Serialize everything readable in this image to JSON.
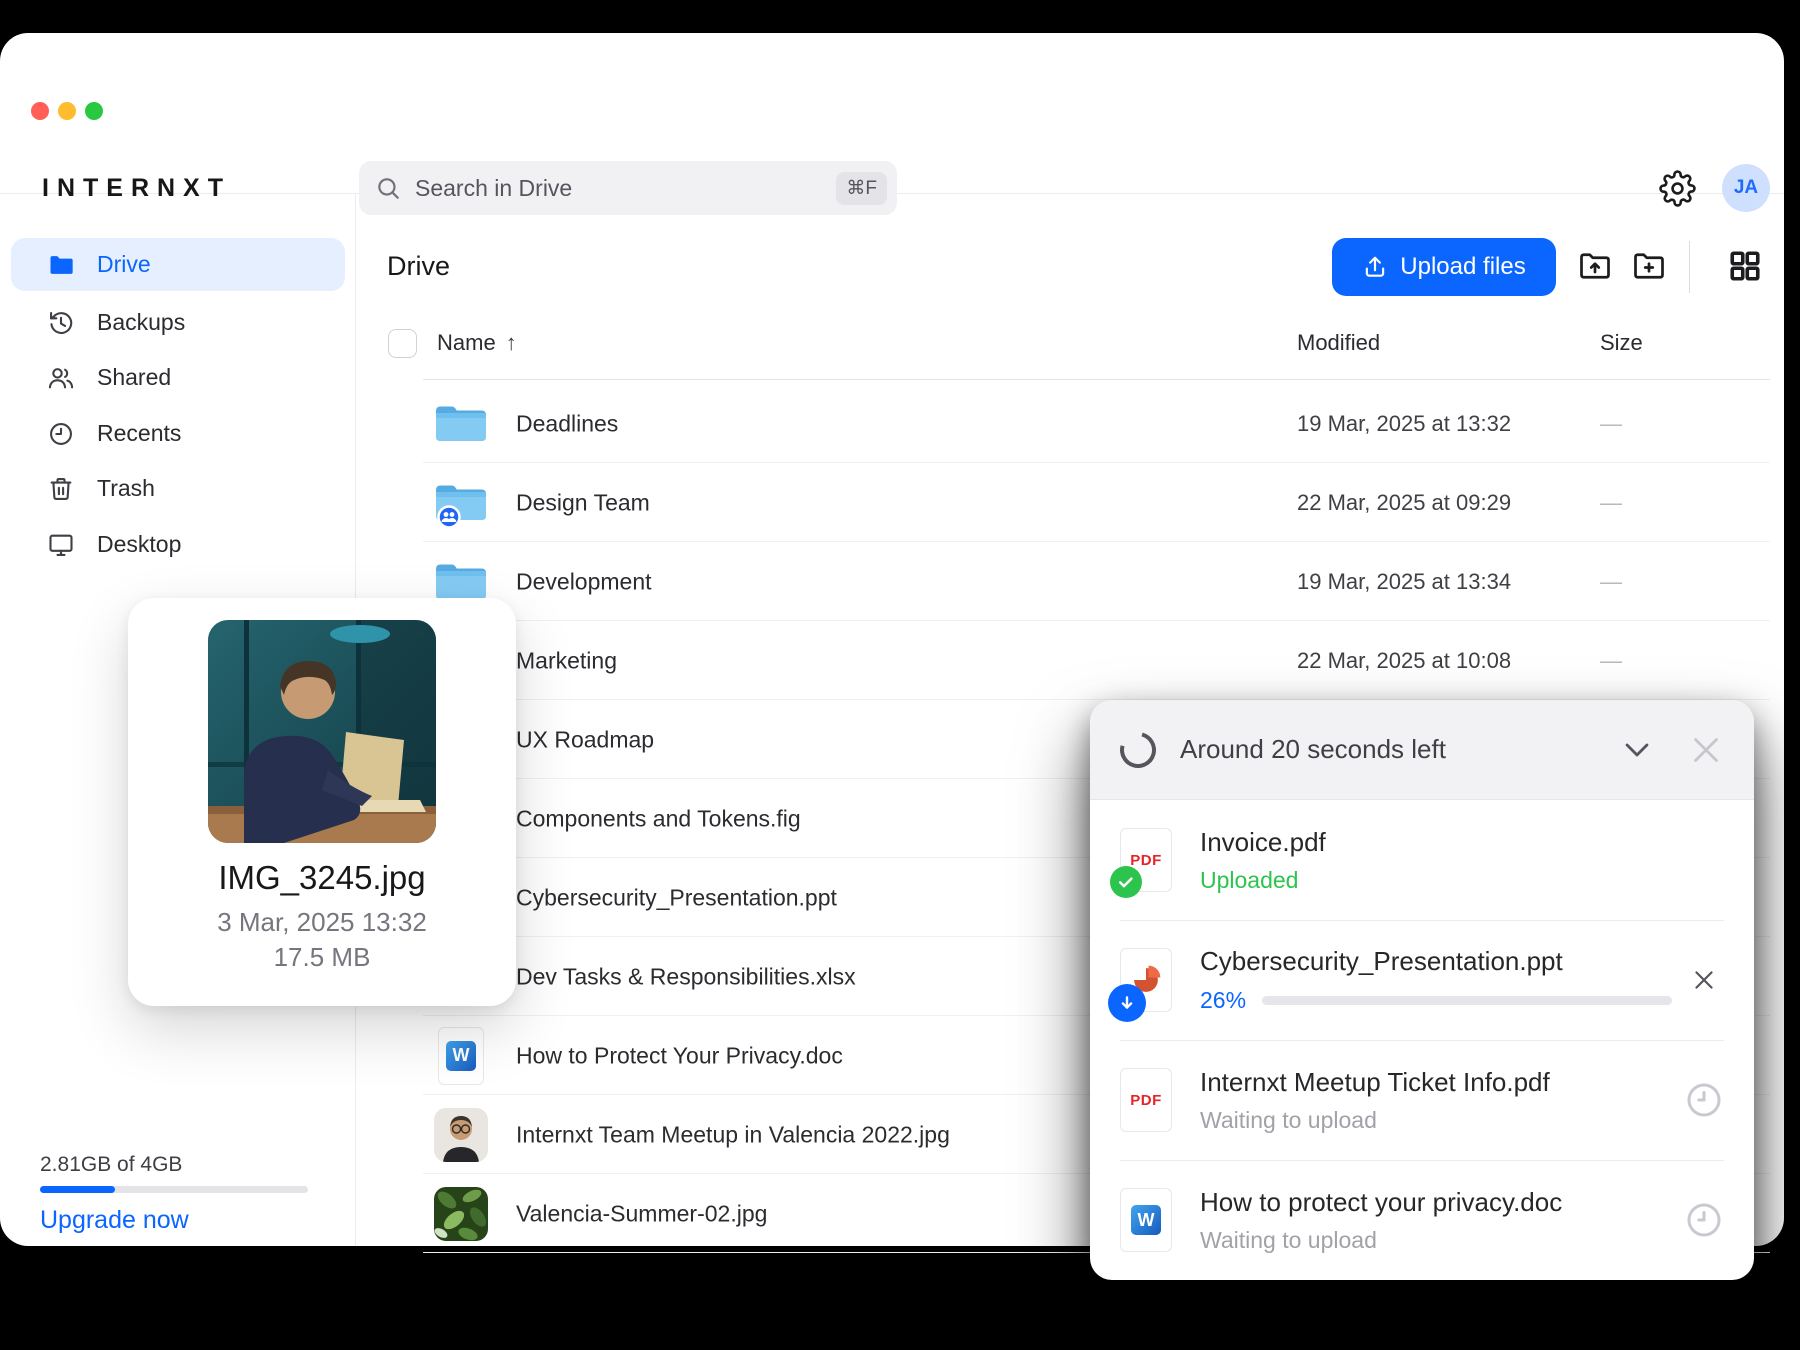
{
  "colors": {
    "accent": "#0a66ff",
    "success_green": "#2dc44d",
    "pdf_red": "#e5252a",
    "ppt_orange": "#d35230",
    "traffic_red": "#ff5f57",
    "traffic_yellow": "#febc2e",
    "traffic_green": "#28c840"
  },
  "brand": {
    "logo": "INTERNXT"
  },
  "topbar": {
    "search": {
      "placeholder": "Search in Drive",
      "shortcut": "⌘F"
    },
    "avatar_initials": "JA"
  },
  "sidebar": {
    "items": [
      {
        "id": "drive",
        "label": "Drive",
        "icon": "folder-blue-icon",
        "active": true
      },
      {
        "id": "backups",
        "label": "Backups",
        "icon": "history-icon",
        "active": false
      },
      {
        "id": "shared",
        "label": "Shared",
        "icon": "users-icon",
        "active": false
      },
      {
        "id": "recents",
        "label": "Recents",
        "icon": "clock-icon",
        "active": false
      },
      {
        "id": "trash",
        "label": "Trash",
        "icon": "trash-icon",
        "active": false
      },
      {
        "id": "desktop",
        "label": "Desktop",
        "icon": "monitor-icon",
        "active": false
      }
    ],
    "storage": {
      "usage_label": "2.81GB of 4GB",
      "percent_filled": 28,
      "upgrade_label": "Upgrade now"
    }
  },
  "main": {
    "title": "Drive",
    "upload_button_label": "Upload files",
    "columns": {
      "name": "Name",
      "sort_arrow": "↑",
      "modified": "Modified",
      "size": "Size"
    },
    "rows": [
      {
        "name": "Deadlines",
        "icon": "folder",
        "modified": "19 Mar, 2025 at 13:32",
        "size": "—"
      },
      {
        "name": "Design Team",
        "icon": "folder-shared",
        "modified": "22 Mar, 2025 at 09:29",
        "size": "—"
      },
      {
        "name": "Development",
        "icon": "folder",
        "modified": "19 Mar, 2025 at 13:34",
        "size": "—"
      },
      {
        "name": "Marketing",
        "icon": "folder",
        "modified": "22 Mar, 2025 at 10:08",
        "size": "—"
      },
      {
        "name": "UX Roadmap",
        "icon": "folder",
        "modified": "",
        "size": ""
      },
      {
        "name": "Components and Tokens.fig",
        "icon": "file",
        "modified": "",
        "size": ""
      },
      {
        "name": "Cybersecurity_Presentation.ppt",
        "icon": "file",
        "modified": "",
        "size": ""
      },
      {
        "name": "Dev Tasks & Responsibilities.xlsx",
        "icon": "file",
        "modified": "",
        "size": ""
      },
      {
        "name": "How to Protect Your Privacy.doc",
        "icon": "word",
        "modified": "",
        "size": ""
      },
      {
        "name": "Internxt Team Meetup in Valencia 2022.jpg",
        "icon": "photo-person",
        "modified": "",
        "size": ""
      },
      {
        "name": "Valencia-Summer-02.jpg",
        "icon": "photo-leaves",
        "modified": "",
        "size": ""
      }
    ]
  },
  "preview_card": {
    "filename": "IMG_3245.jpg",
    "date": "3 Mar, 2025 13:32",
    "size": "17.5 MB"
  },
  "upload_panel": {
    "header": "Around 20 seconds left",
    "items": [
      {
        "name": "Invoice.pdf",
        "icon": "pdf",
        "badge": "check",
        "status": "Uploaded",
        "status_type": "success",
        "right": "none"
      },
      {
        "name": "Cybersecurity_Presentation.ppt",
        "icon": "ppt",
        "badge": "down",
        "status_type": "progress",
        "percent_label": "26%",
        "percent": 26,
        "right": "close"
      },
      {
        "name": "Internxt Meetup Ticket Info.pdf",
        "icon": "pdf",
        "badge": "none",
        "status": "Waiting to upload",
        "status_type": "waiting",
        "right": "clock"
      },
      {
        "name": "How to protect your privacy.doc",
        "icon": "word",
        "badge": "none",
        "status": "Waiting to upload",
        "status_type": "waiting",
        "right": "clock"
      }
    ]
  }
}
